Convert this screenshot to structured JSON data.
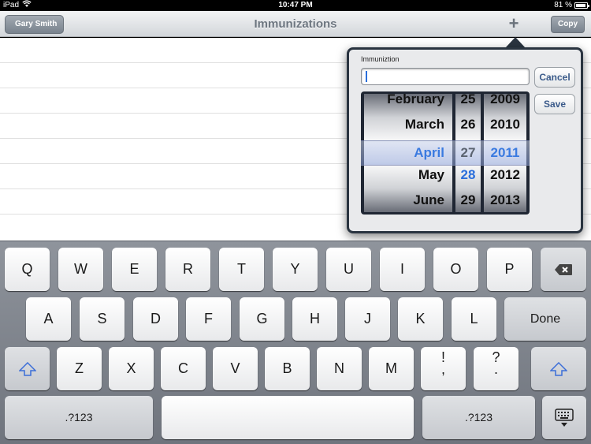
{
  "status_bar": {
    "carrier": "iPad",
    "time": "10:47 PM",
    "battery_pct": "81 %",
    "battery_level": 0.81
  },
  "navbar": {
    "title": "Immunizations",
    "back_label": "Gary Smith",
    "add_label": "+",
    "copy_label": "Copy"
  },
  "popover": {
    "field_label": "Immuniztion",
    "input_value": "",
    "cancel_label": "Cancel",
    "save_label": "Save",
    "picker": {
      "months": [
        "February",
        "March",
        "April",
        "May",
        "June"
      ],
      "days": [
        "25",
        "26",
        "27",
        "28",
        "29"
      ],
      "years": [
        "2009",
        "2010",
        "2011",
        "2012",
        "2013"
      ],
      "selected": {
        "month": "April",
        "day": "27",
        "year": "2011"
      },
      "today_day": "28",
      "accent_color": "#3a7ae0"
    }
  },
  "keyboard": {
    "row1": [
      "Q",
      "W",
      "E",
      "R",
      "T",
      "Y",
      "U",
      "I",
      "O",
      "P"
    ],
    "row2": [
      "A",
      "S",
      "D",
      "F",
      "G",
      "H",
      "J",
      "K",
      "L"
    ],
    "row3": [
      "Z",
      "X",
      "C",
      "V",
      "B",
      "N",
      "M"
    ],
    "done_label": "Done",
    "num_label": ".?123",
    "punct1": [
      "!",
      ","
    ],
    "punct2": [
      "?",
      "."
    ],
    "icons": {
      "backspace": "backspace-icon",
      "shift": "shift-icon",
      "hide": "keyboard-hide-icon"
    }
  }
}
